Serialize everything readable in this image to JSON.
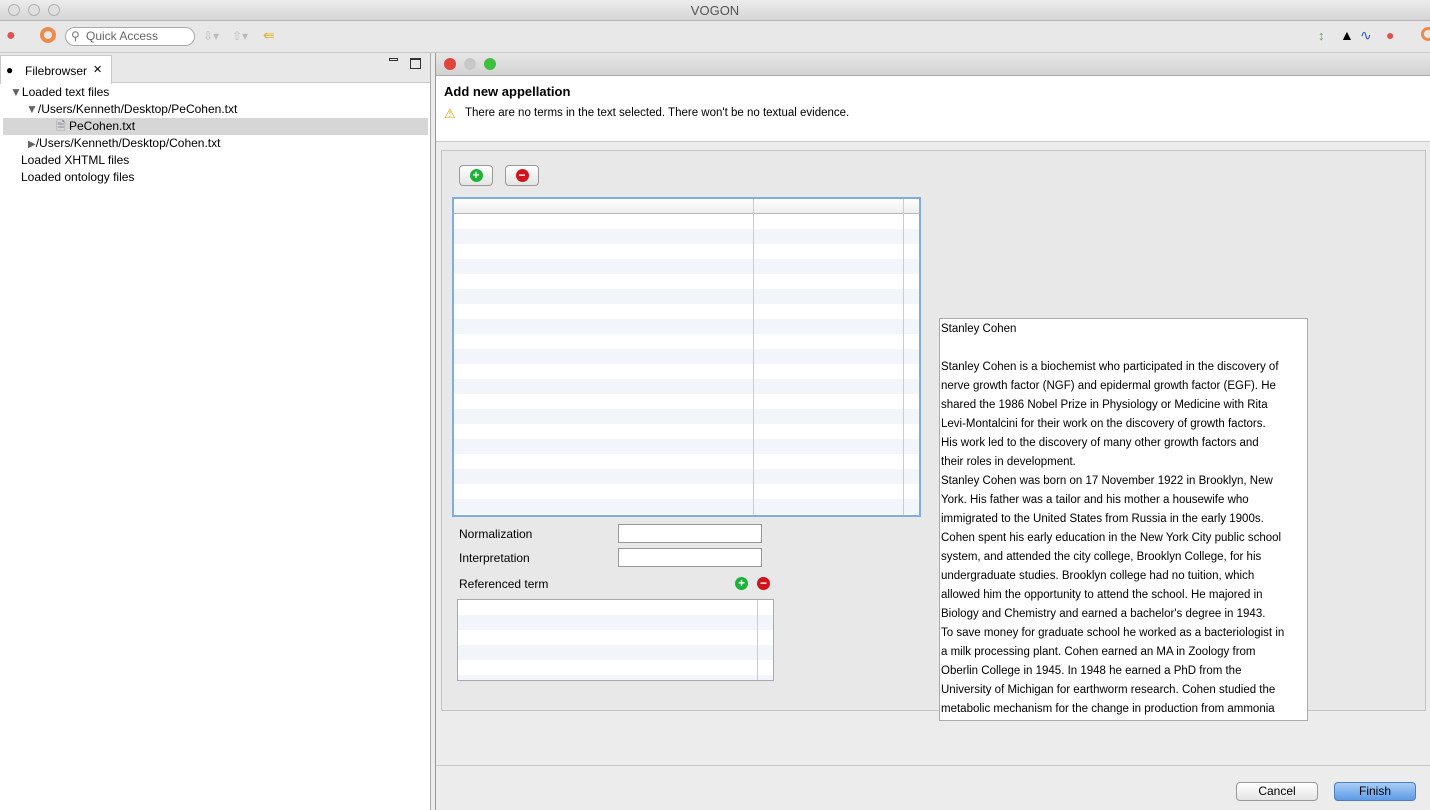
{
  "window": {
    "title": "VOGON"
  },
  "toolbar": {
    "quick_access_placeholder": "Quick Access"
  },
  "filebrowser": {
    "tab_label": "Filebrowser",
    "tree": [
      {
        "label": "Loaded text files",
        "expanded": true
      },
      {
        "label": "/Users/Kenneth/Desktop/PeCohen.txt",
        "expanded": true
      },
      {
        "label": "PeCohen.txt",
        "selected": true
      },
      {
        "label": "/Users/Kenneth/Desktop/Cohen.txt",
        "expanded": false
      },
      {
        "label": "Loaded XHTML files"
      },
      {
        "label": "Loaded ontology files"
      }
    ]
  },
  "dialog": {
    "title": "Add new appellation",
    "warning": "There are no terms in the text selected. There won't be no textual evidence.",
    "normalization_label": "Normalization",
    "normalization_value": "",
    "interpretation_label": "Interpretation",
    "interpretation_value": "",
    "referenced_term_label": "Referenced term",
    "text_lines": [
      "Stanley Cohen",
      "",
      "Stanley Cohen is a biochemist who participated in the discovery of",
      "nerve growth factor (NGF) and epidermal growth factor (EGF).  He",
      "shared the 1986 Nobel Prize in Physiology or Medicine with Rita",
      "Levi-Montalcini for their work on the discovery of growth factors.",
      "His work led to the discovery of many other growth factors and",
      "their roles in development.",
      "Stanley Cohen was born on 17 November 1922 in Brooklyn, New",
      "York.  His father was a tailor and his mother a housewife who",
      "immigrated to the United States from Russia in the early 1900s.",
      "Cohen spent his early education in the New York City public school",
      "system, and attended the city college, Brooklyn College, for his",
      "undergraduate studies.  Brooklyn college had no tuition, which",
      "allowed him the opportunity to attend the school.  He majored in",
      "Biology and Chemistry and earned a bachelor's degree in 1943.",
      "To save money for graduate school he worked as a bacteriologist in",
      "a milk processing plant.  Cohen earned an MA in Zoology from",
      "Oberlin College in 1945.  In 1948 he earned a PhD from the",
      "University of Michigan for earthworm research.  Cohen studied the",
      "metabolic mechanism for the change in production from ammonia"
    ],
    "cancel_label": "Cancel",
    "finish_label": "Finish"
  },
  "colors": {
    "accent": "#4a90d9",
    "add": "#1bb338",
    "remove": "#d0141b",
    "stripe": "#f2f5fa"
  }
}
